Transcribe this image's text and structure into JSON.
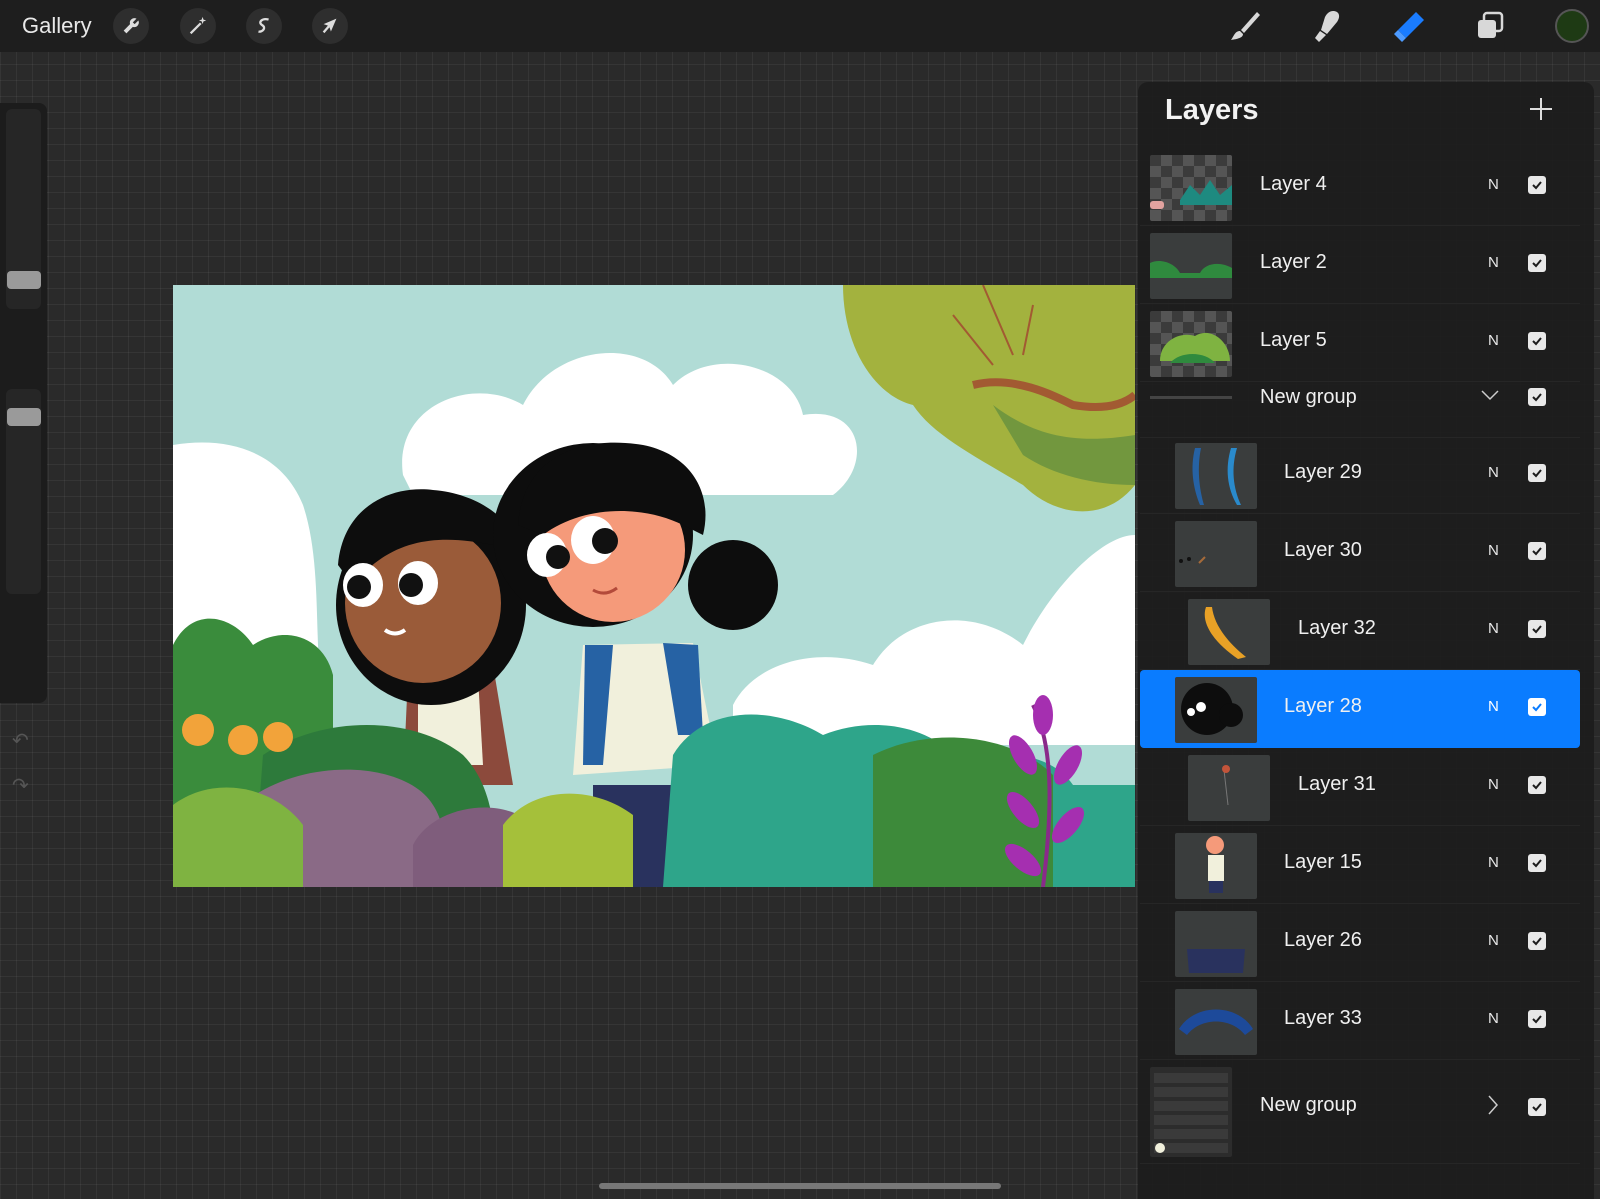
{
  "toolbar": {
    "gallery_label": "Gallery",
    "left_tools": [
      "wrench-icon",
      "magic-wand-icon",
      "selection-icon",
      "transform-arrow-icon"
    ],
    "right_tools": [
      "brush-icon",
      "smudge-icon",
      "eraser-icon",
      "layers-icon"
    ],
    "active_tool": "eraser-icon",
    "accent_color": "#0a7cff",
    "current_color": "#1e3a14"
  },
  "sidebar": {
    "brush_size_level": 0.18,
    "opacity_level": 0.7,
    "modify_button": "square-icon",
    "undo_icon": "undo-icon",
    "redo_icon": "redo-icon"
  },
  "layers_panel": {
    "title": "Layers",
    "add_icon": "plus-icon",
    "blend_mode": "N",
    "layers": [
      {
        "name": "Layer 4",
        "visible": true
      },
      {
        "name": "Layer 2",
        "visible": true
      },
      {
        "name": "Layer 5",
        "visible": true
      },
      {
        "name": "New group",
        "visible": true,
        "group": true,
        "expanded": true
      },
      {
        "name": "Layer 29",
        "visible": true
      },
      {
        "name": "Layer 30",
        "visible": true
      },
      {
        "name": "Layer 32",
        "visible": true,
        "clipped": true
      },
      {
        "name": "Layer 28",
        "visible": true,
        "selected": true
      },
      {
        "name": "Layer 31",
        "visible": true,
        "clipped": true
      },
      {
        "name": "Layer 15",
        "visible": true
      },
      {
        "name": "Layer 26",
        "visible": true
      },
      {
        "name": "Layer 33",
        "visible": true
      },
      {
        "name": "New group",
        "visible": true,
        "group": true,
        "expanded": false
      }
    ]
  }
}
